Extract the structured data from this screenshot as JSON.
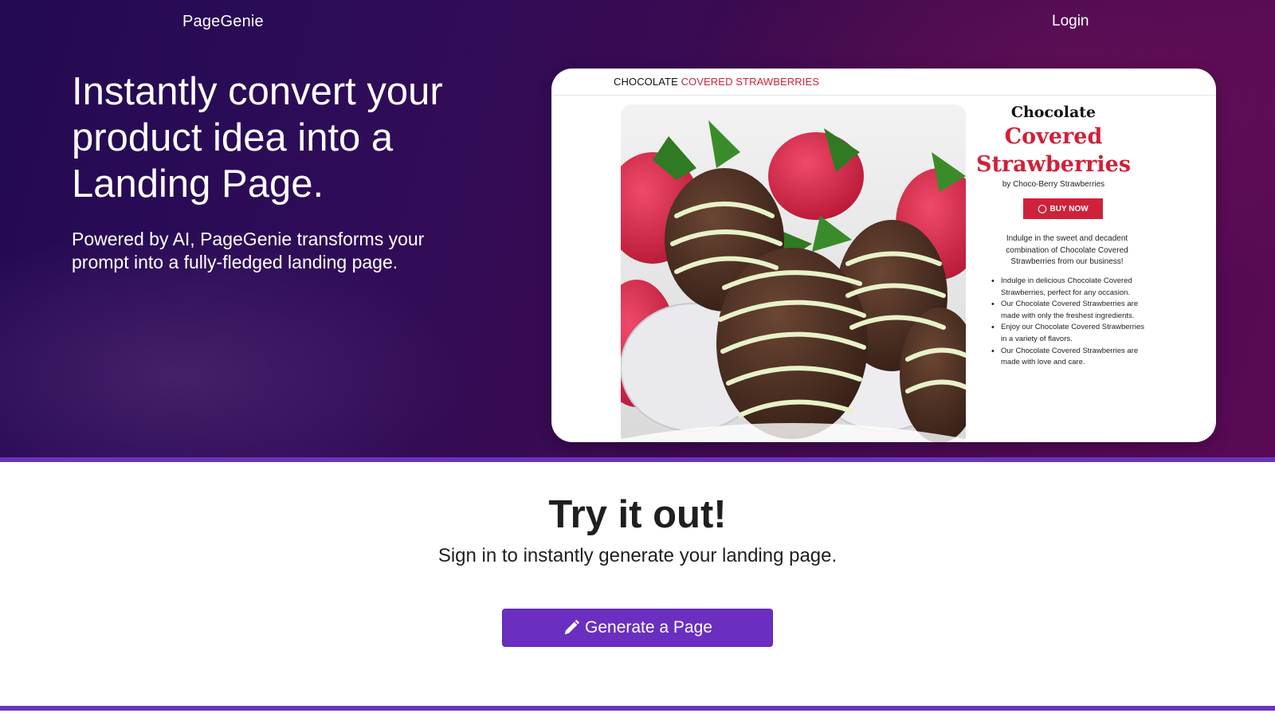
{
  "header": {
    "brand": "PageGenie",
    "login_label": "Login"
  },
  "hero": {
    "headline": "Instantly convert your product idea into a Landing Page.",
    "subheadline": "Powered by AI, PageGenie transforms your prompt into a fully-fledged landing page."
  },
  "preview": {
    "nav_brand_part1": "CHOCOLATE ",
    "nav_brand_part2": "COVERED STRAWBERRIES",
    "title_line1": "Chocolate",
    "title_line2": "Covered Strawberries",
    "byline": "by Choco-Berry Strawberries",
    "buy_label": "BUY NOW",
    "description": "Indulge in the sweet and decadent combination of Chocolate Covered Strawberries from our business!",
    "bullets": [
      "Indulge in delicious Chocolate Covered Strawberries, perfect for any occasion.",
      "Our Chocolate Covered Strawberries are made with only the freshest ingredients.",
      "Enjoy our Chocolate Covered Strawberries in a variety of flavors.",
      "Our Chocolate Covered Strawberries are made with love and care."
    ],
    "image_icon": "product-photo"
  },
  "cta": {
    "title": "Try it out!",
    "subtitle": "Sign in to instantly generate your landing page.",
    "button_label": "Generate a Page",
    "button_icon": "pencil-icon"
  },
  "colors": {
    "hero_start": "#230a52",
    "hero_end": "#5a0a55",
    "accent": "#6a2fc0",
    "brand_red": "#d0213a"
  }
}
